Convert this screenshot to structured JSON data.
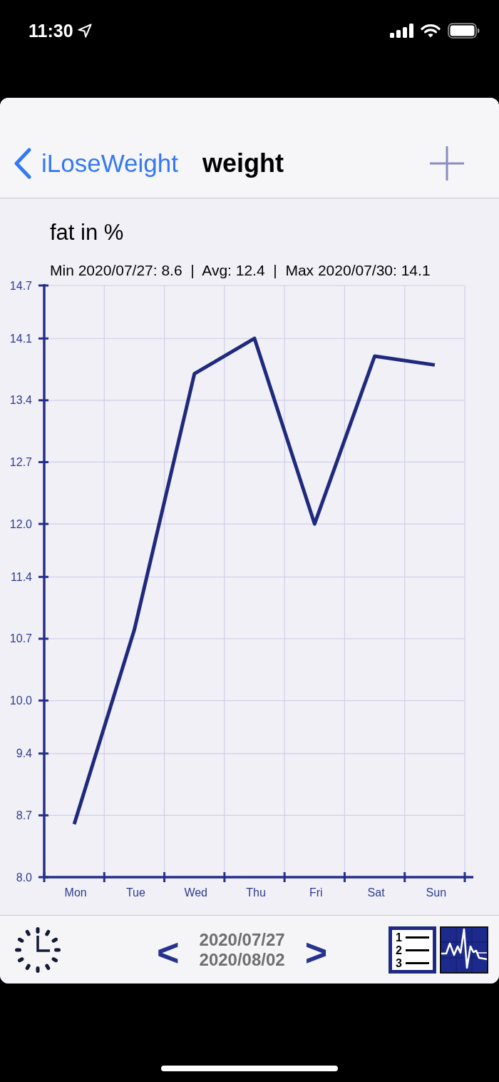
{
  "status_bar": {
    "time": "11:30"
  },
  "nav_bar": {
    "back_label": "iLoseWeight",
    "title": "weight"
  },
  "chart": {
    "summary": "Min 2020/07/27: 8.6  |  Avg: 12.4  |  Max 2020/07/30: 14.1",
    "chart_data": {
      "type": "line",
      "title": "fat in %",
      "grid": true,
      "categories": [
        "Mon",
        "Tue",
        "Wed",
        "Thu",
        "Fri",
        "Sat",
        "Sun"
      ],
      "values": [
        8.6,
        10.8,
        13.7,
        14.1,
        12.0,
        13.9,
        13.8
      ],
      "ylim": [
        8.0,
        14.7
      ],
      "yticks": [
        {
          "value": 8.0,
          "label": "8.0"
        },
        {
          "value": 8.7,
          "label": "8.7"
        },
        {
          "value": 9.4,
          "label": "9.4"
        },
        {
          "value": 10.0,
          "label": "10.0"
        },
        {
          "value": 10.7,
          "label": "10.7"
        },
        {
          "value": 11.4,
          "label": "11.4"
        },
        {
          "value": 12.0,
          "label": "12.0"
        },
        {
          "value": 12.7,
          "label": "12.7"
        },
        {
          "value": 13.4,
          "label": "13.4"
        },
        {
          "value": 14.1,
          "label": "14.1"
        },
        {
          "value": 14.7,
          "label": "14.7"
        }
      ]
    }
  },
  "toolbar": {
    "prev_label": "<",
    "date_from": "2020/07/27",
    "date_to": "2020/08/02",
    "next_label": ">",
    "list_numbers": [
      "1",
      "2",
      "3"
    ]
  }
}
